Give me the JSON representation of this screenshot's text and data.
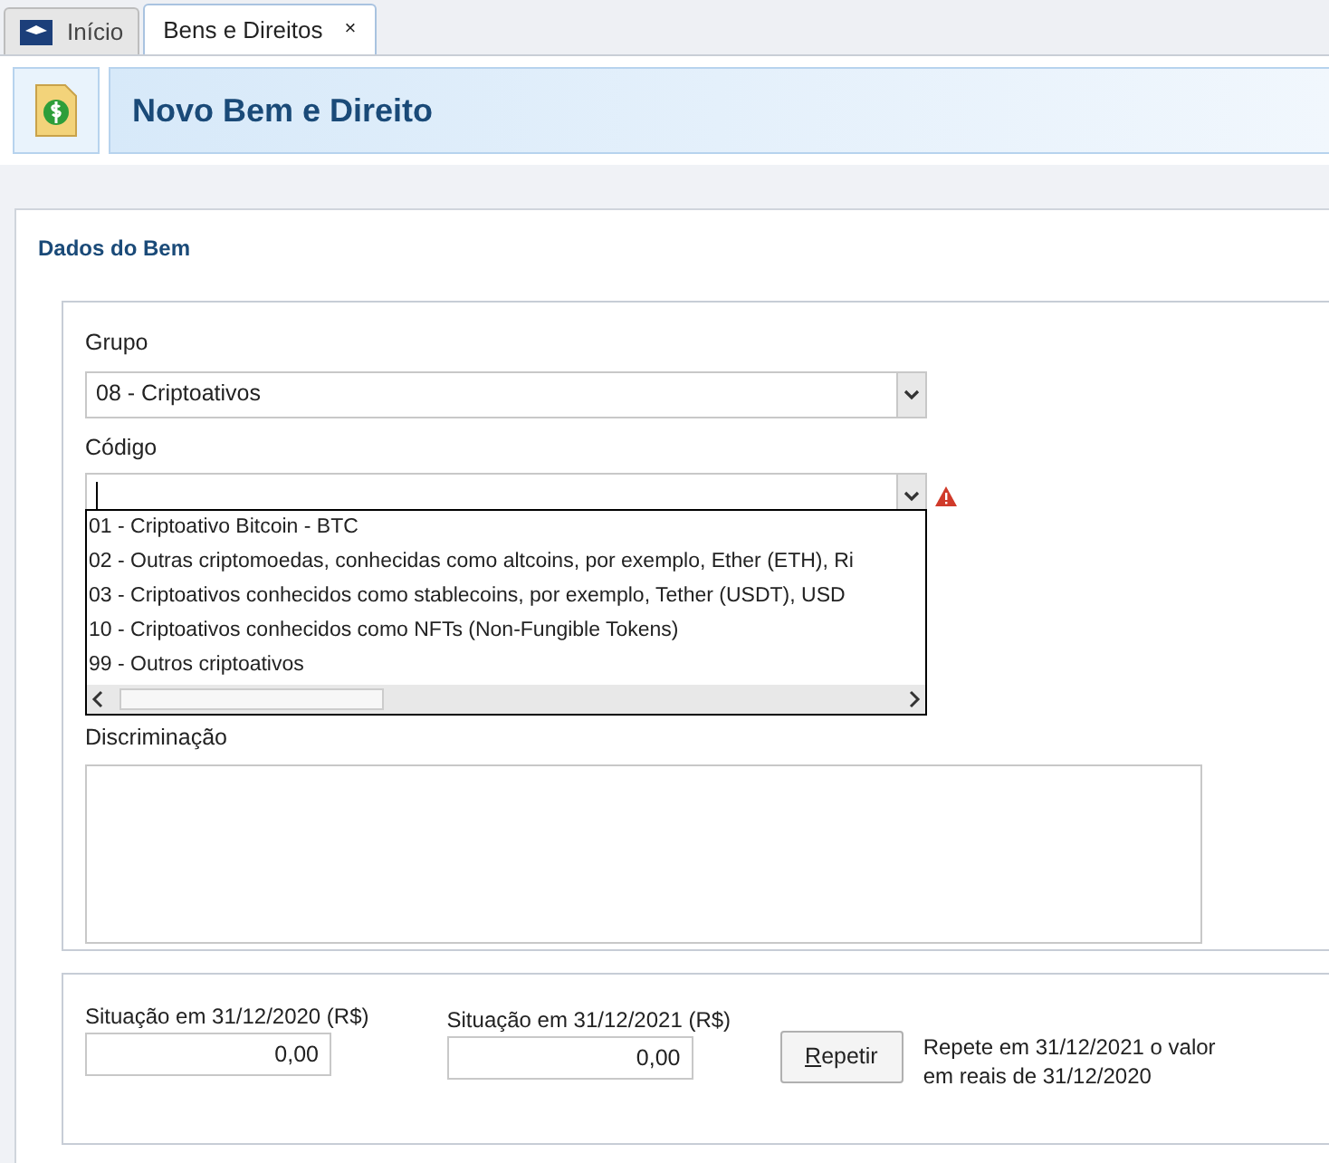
{
  "tabs": [
    {
      "label": "Início",
      "selected": false,
      "closable": false
    },
    {
      "label": "Bens e Direitos",
      "selected": true,
      "closable": true
    }
  ],
  "close_glyph": "×",
  "header": {
    "title": "Novo Bem e Direito"
  },
  "section": {
    "title": "Dados do Bem"
  },
  "grupo": {
    "label": "Grupo",
    "value": "08 - Criptoativos"
  },
  "codigo": {
    "label": "Código",
    "error": true,
    "options": [
      {
        "label": "01 - Criptoativo Bitcoin - BTC"
      },
      {
        "label": "02 - Outras criptomoedas, conhecidas como altcoins, por exemplo, Ether (ETH), Ri"
      },
      {
        "label": "03 - Criptoativos conhecidos como stablecoins, por exemplo, Tether (USDT), USD"
      },
      {
        "label": "10 - Criptoativos conhecidos como NFTs (Non-Fungible Tokens)"
      },
      {
        "label": "99 - Outros criptoativos"
      }
    ]
  },
  "discriminacao": {
    "label": "Discriminação"
  },
  "values": [
    {
      "label": "Situação em 31/12/2020 (R$)",
      "value": "0,00"
    },
    {
      "label": "Situação em 31/12/2021 (R$)",
      "value": "0,00"
    }
  ],
  "repeat_button": "Repetir",
  "repeat_hint": "Repete em 31/12/2021 o valor em reais de 31/12/2020"
}
